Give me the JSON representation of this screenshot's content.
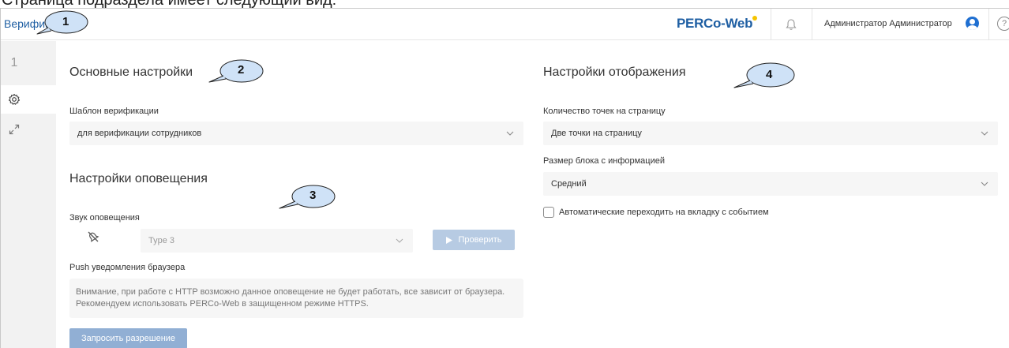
{
  "caption": "Страница подраздела имеет следующий вид:",
  "header": {
    "title": "Верификация",
    "logo": "PERCo-Web",
    "user": "Администратор Администратор",
    "help": "?"
  },
  "sidebar": {
    "items": [
      {
        "label": "1",
        "icon": ""
      },
      {
        "label": "",
        "icon": "gear-icon"
      },
      {
        "label": "",
        "icon": "expand-icon"
      }
    ]
  },
  "main": {
    "basic": {
      "title": "Основные настройки",
      "template_label": "Шаблон верификации",
      "template_value": "для верификации сотрудников"
    },
    "notify": {
      "title": "Настройки оповещения",
      "sound_label": "Звук оповещения",
      "sound_value": "Type 3",
      "check_button": "Проверить",
      "push_label": "Push уведомления браузера",
      "notice_line1": "Внимание, при работе с HTTP возможно данное оповещение не будет работать, все зависит от браузера.",
      "notice_line2": "Рекомендуем использовать PERCo-Web в защищенном режиме HTTPS.",
      "permission_button": "Запросить разрешение"
    },
    "display": {
      "title": "Настройки отображения",
      "points_label": "Количество точек на страницу",
      "points_value": "Две точки на страницу",
      "block_label": "Размер блока с информацией",
      "block_value": "Средний",
      "auto_switch_label": "Автоматические переходить на вкладку с событием",
      "auto_switch_checked": false
    }
  },
  "callouts": [
    "1",
    "2",
    "3",
    "4"
  ],
  "colors": {
    "brand": "#1f5fa3",
    "logo_dot": "#f5c400",
    "button_disabled": "#b7cbe3",
    "button": "#91afd4",
    "callout_fill": "#cfe2f7"
  }
}
